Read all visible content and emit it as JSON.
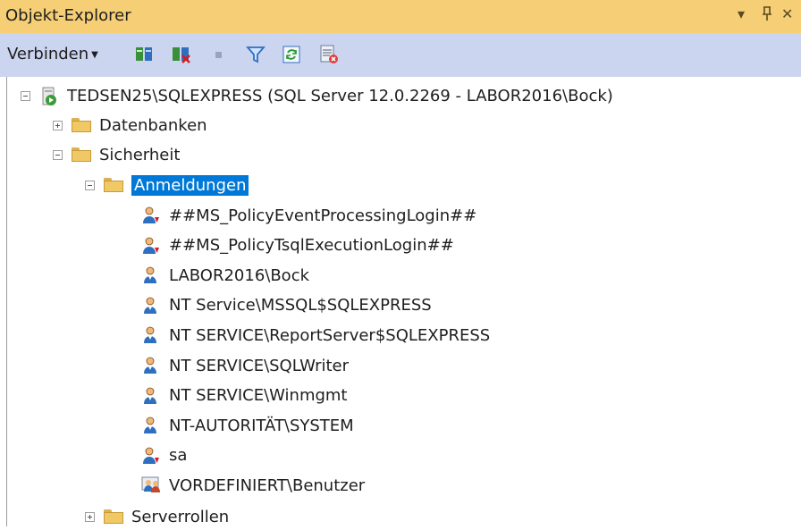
{
  "window": {
    "title": "Objekt-Explorer",
    "controls": [
      "▾",
      "ᵖ",
      "✕"
    ]
  },
  "toolbar": {
    "connect_label": "Verbinden",
    "buttons": [
      "connect-icon",
      "disconnect-icon",
      "stop-icon",
      "filter-icon",
      "refresh-icon",
      "activity-icon"
    ]
  },
  "tree": {
    "server": "TEDSEN25\\SQLEXPRESS (SQL Server 12.0.2269 - LABOR2016\\Bock)",
    "databases": "Datenbanken",
    "security": "Sicherheit",
    "logins": "Anmeldungen",
    "login_items": [
      {
        "label": "##MS_PolicyEventProcessingLogin##",
        "icon": "login-disabled-icon"
      },
      {
        "label": "##MS_PolicyTsqlExecutionLogin##",
        "icon": "login-disabled-icon"
      },
      {
        "label": "LABOR2016\\Bock",
        "icon": "login-icon"
      },
      {
        "label": "NT Service\\MSSQL$SQLEXPRESS",
        "icon": "login-icon"
      },
      {
        "label": "NT SERVICE\\ReportServer$SQLEXPRESS",
        "icon": "login-icon"
      },
      {
        "label": "NT SERVICE\\SQLWriter",
        "icon": "login-icon"
      },
      {
        "label": "NT SERVICE\\Winmgmt",
        "icon": "login-icon"
      },
      {
        "label": "NT-AUTORITÄT\\SYSTEM",
        "icon": "login-icon"
      },
      {
        "label": "sa",
        "icon": "login-disabled-icon"
      },
      {
        "label": "VORDEFINIERT\\Benutzer",
        "icon": "group-login-icon"
      }
    ],
    "server_roles": "Serverrollen"
  },
  "colors": {
    "title_bar": "#f5ce75",
    "toolbar": "#ccd5f0",
    "selection": "#0078d7"
  }
}
